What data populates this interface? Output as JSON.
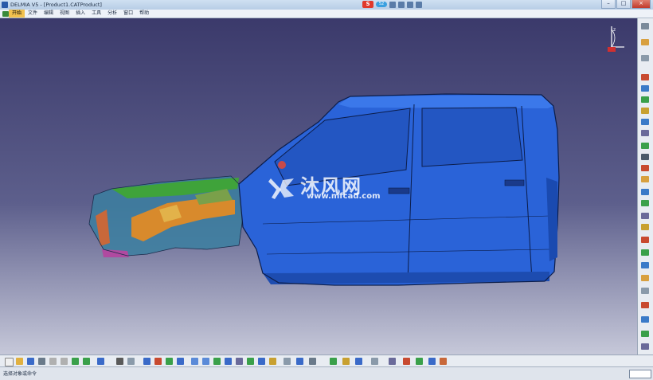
{
  "window": {
    "title": "DELMIA V5 - [Product1.CATProduct]",
    "minimize": "–",
    "maximize": "□",
    "close": "×"
  },
  "ime": {
    "logo": "S",
    "badge": "52"
  },
  "menu": {
    "items": [
      {
        "label": "开始",
        "active": true
      },
      {
        "label": "文件"
      },
      {
        "label": "编辑"
      },
      {
        "label": "视图"
      },
      {
        "label": "插入"
      },
      {
        "label": "工具"
      },
      {
        "label": "分析"
      },
      {
        "label": "窗口"
      },
      {
        "label": "帮助"
      }
    ]
  },
  "watermark": {
    "brand": "沐风网",
    "url": "www.mfcad.com"
  },
  "compass": {
    "label": "z"
  },
  "status": {
    "prompt": "选择对象或命令"
  },
  "colors": {
    "car_body": "#2a63d8",
    "chassis_green": "#3fa33a",
    "chassis_orange": "#d88a2c",
    "background_top": "#3b3a6b",
    "background_bottom": "#c6c8d9"
  }
}
